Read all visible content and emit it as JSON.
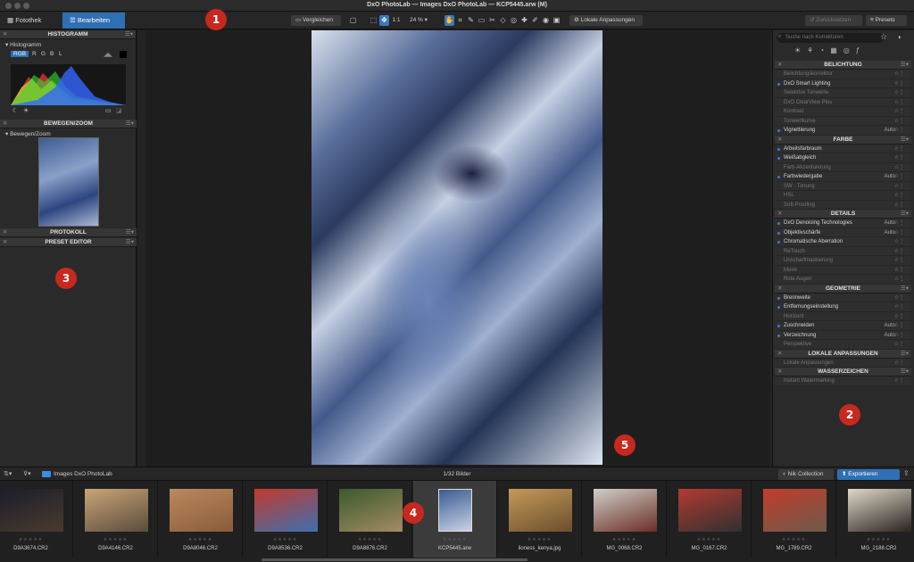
{
  "window": {
    "title": "DxO PhotoLab — Images DxO PhotoLab — KCP5445.arw (M)"
  },
  "toolbar": {
    "tab_library": "Fotothek",
    "tab_edit": "Bearbeiten",
    "compare": "Vergleichen",
    "one_to_one": "1:1",
    "zoom": "24 %",
    "local_adjust": "Lokale Anpassungen",
    "reset": "Zurücksetzen",
    "presets": "Presets"
  },
  "left": {
    "histogram_title": "HISTOGRAMM",
    "histogram_sub": "Histogramm",
    "channels": [
      "RGB",
      "R",
      "G",
      "B",
      "L"
    ],
    "move_zoom_title": "BEWEGEN/ZOOM",
    "move_zoom_sub": "Bewegen/Zoom",
    "history_title": "PROTOKOLL",
    "preset_editor_title": "PRESET EDITOR"
  },
  "right": {
    "search_placeholder": "Suche nach Korrekturen",
    "sections": [
      {
        "title": "BELICHTUNG",
        "rows": [
          {
            "label": "Belichtungskorrektur",
            "value": "",
            "active": false
          },
          {
            "label": "DxO Smart Lighting",
            "value": "",
            "active": true
          },
          {
            "label": "Selektive Tonwerte",
            "value": "",
            "active": false
          },
          {
            "label": "DxO ClearView Plus",
            "value": "",
            "active": false
          },
          {
            "label": "Kontrast",
            "value": "",
            "active": false
          },
          {
            "label": "Tonwertkurve",
            "value": "",
            "active": false
          },
          {
            "label": "Vignettierung",
            "value": "Auto",
            "active": true
          }
        ]
      },
      {
        "title": "FARBE",
        "rows": [
          {
            "label": "Arbeitsfarbraum",
            "value": "",
            "active": true
          },
          {
            "label": "Weißabgleich",
            "value": "",
            "active": true
          },
          {
            "label": "Farb-Akzentuierung",
            "value": "",
            "active": false
          },
          {
            "label": "Farbwiedergabe",
            "value": "Auto",
            "active": true
          },
          {
            "label": "SW - Tonung",
            "value": "",
            "active": false
          },
          {
            "label": "HSL",
            "value": "",
            "active": false
          },
          {
            "label": "Soft-Proofing",
            "value": "",
            "active": false
          }
        ]
      },
      {
        "title": "DETAILS",
        "rows": [
          {
            "label": "DxO Denoising Technologies",
            "value": "Auto",
            "active": true
          },
          {
            "label": "Objektivschärfe",
            "value": "Auto",
            "active": true
          },
          {
            "label": "Chromatische Aberration",
            "value": "",
            "active": true
          },
          {
            "label": "ReTouch",
            "value": "",
            "active": false
          },
          {
            "label": "Unscharfmaskierung",
            "value": "",
            "active": false
          },
          {
            "label": "Moiré",
            "value": "",
            "active": false
          },
          {
            "label": "Rote Augen",
            "value": "",
            "active": false
          }
        ]
      },
      {
        "title": "GEOMETRIE",
        "rows": [
          {
            "label": "Brennweite",
            "value": "",
            "active": true
          },
          {
            "label": "Entfernungseinstellung",
            "value": "",
            "active": true
          },
          {
            "label": "Horizont",
            "value": "",
            "active": false
          },
          {
            "label": "Zuschneiden",
            "value": "Auto",
            "active": true
          },
          {
            "label": "Verzeichnung",
            "value": "Auto",
            "active": true
          },
          {
            "label": "Perspektive",
            "value": "",
            "active": false
          }
        ]
      },
      {
        "title": "LOKALE ANPASSUNGEN",
        "rows": [
          {
            "label": "Lokale Anpassungen",
            "value": "",
            "active": false
          }
        ]
      },
      {
        "title": "WASSERZEICHEN",
        "rows": [
          {
            "label": "Instant Watermarking",
            "value": "",
            "active": false
          }
        ]
      }
    ]
  },
  "filmbar": {
    "folder": "Images DxO PhotoLab",
    "count": "1/32 Bilder",
    "nik": "Nik Collection",
    "export": "Exportieren"
  },
  "filmstrip": [
    {
      "name": "D9A3674.CR2",
      "colors": [
        "#1b1e2a",
        "#4a3a2e"
      ]
    },
    {
      "name": "D9A4146.CR2",
      "colors": [
        "#c9a577",
        "#5a4c3c"
      ]
    },
    {
      "name": "D9A8046.CR2",
      "colors": [
        "#b98a5e",
        "#8a5b3a"
      ]
    },
    {
      "name": "D9A8536.CR2",
      "colors": [
        "#c23a2c",
        "#3d6fb0"
      ]
    },
    {
      "name": "D9A8876.CR2",
      "colors": [
        "#3a5a2c",
        "#a58a64"
      ]
    },
    {
      "name": "KCP5445.arw",
      "colors": [
        "#3b5c92",
        "#c9d2e4"
      ],
      "selected": true
    },
    {
      "name": "lioness_kenya.jpg",
      "colors": [
        "#c49a5a",
        "#6a4e2c"
      ]
    },
    {
      "name": "MG_0068.CR2",
      "colors": [
        "#d0cfc9",
        "#6a2e26"
      ]
    },
    {
      "name": "MG_0167.CR2",
      "colors": [
        "#b33a30",
        "#303030"
      ]
    },
    {
      "name": "MG_1789.CR2",
      "colors": [
        "#c23d2c",
        "#6d5a4a"
      ]
    },
    {
      "name": "MG_2188.CR2",
      "colors": [
        "#e0d8c8",
        "#2a2420"
      ]
    }
  ],
  "badges": [
    "1",
    "2",
    "3",
    "4",
    "5"
  ]
}
